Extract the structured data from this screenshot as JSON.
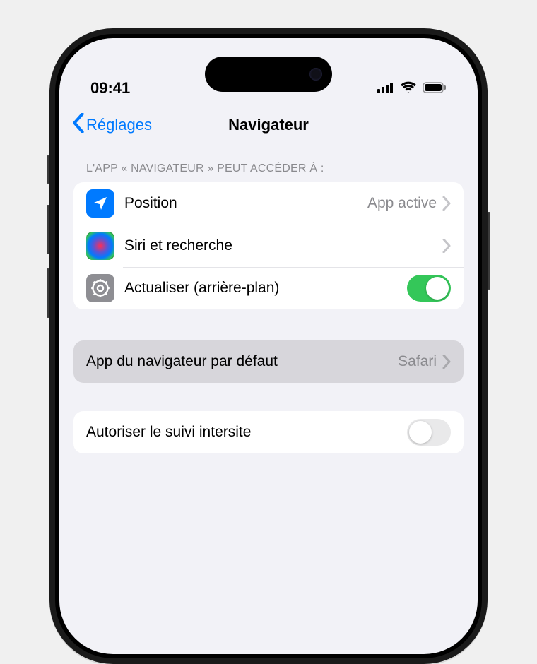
{
  "statusBar": {
    "time": "09:41"
  },
  "nav": {
    "back": "Réglages",
    "title": "Navigateur"
  },
  "sections": {
    "accessHeader": "L'APP « NAVIGATEUR » PEUT ACCÉDER À :",
    "rows": {
      "location": {
        "label": "Position",
        "value": "App active"
      },
      "siri": {
        "label": "Siri et recherche"
      },
      "refresh": {
        "label": "Actualiser (arrière-plan)",
        "enabled": true
      }
    },
    "defaultBrowser": {
      "label": "App du navigateur par défaut",
      "value": "Safari"
    },
    "crossSite": {
      "label": "Autoriser le suivi intersite",
      "enabled": false
    }
  }
}
